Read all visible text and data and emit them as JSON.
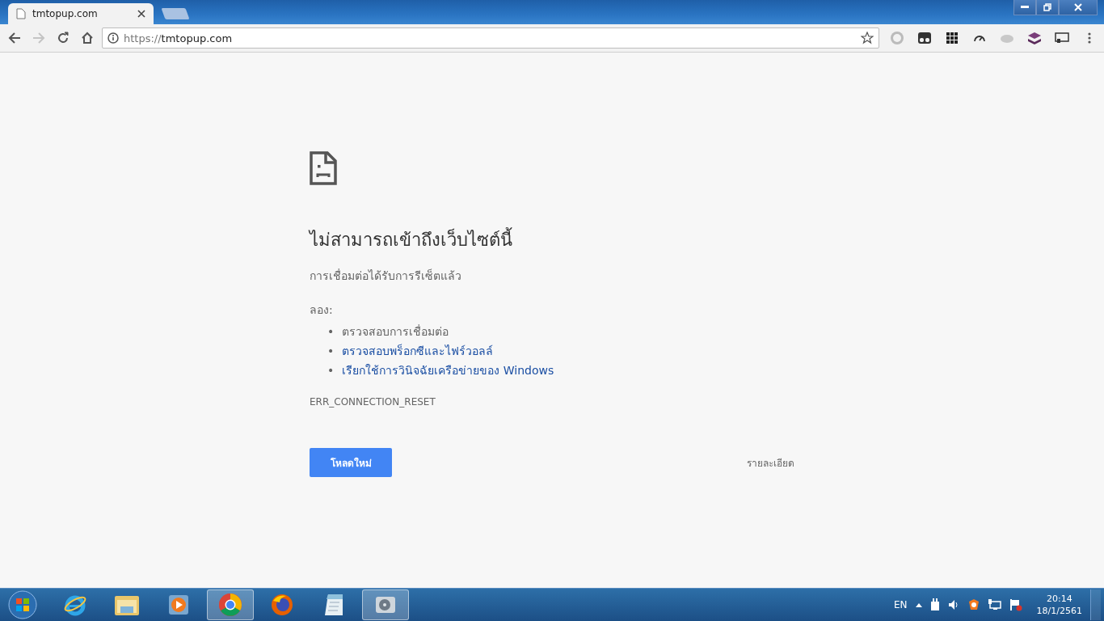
{
  "tabs": [
    {
      "title": "tmtopup.com",
      "selected": true
    }
  ],
  "navigation": {
    "back_disabled": false,
    "forward_disabled": true
  },
  "address_bar": {
    "scheme": "https://",
    "host": "tmtopup.com"
  },
  "error_page": {
    "heading": "ไม่สามารถเข้าถึงเว็บไซต์นี้",
    "description": "การเชื่อมต่อได้รับการรีเซ็ตแล้ว",
    "try_label": "ลอง:",
    "suggestions": [
      {
        "bullet": "•",
        "text": "ตรวจสอบการเชื่อมต่อ",
        "kind": "plain"
      },
      {
        "bullet": "•",
        "text": "ตรวจสอบพร็อกซีและไฟร์วอลล์",
        "kind": "link"
      },
      {
        "bullet": "•",
        "text": "เรียกใช้การวินิจฉัยเครือข่ายของ Windows",
        "kind": "link"
      }
    ],
    "error_code": "ERR_CONNECTION_RESET",
    "reload_button": "โหลดใหม่",
    "details_button": "รายละเอียด"
  },
  "taskbar": {
    "apps": [
      {
        "kind": "ie",
        "selected": false
      },
      {
        "kind": "folder",
        "selected": false
      },
      {
        "kind": "media",
        "selected": false
      },
      {
        "kind": "chrome",
        "selected": true
      },
      {
        "kind": "firefox",
        "selected": false
      },
      {
        "kind": "notepad",
        "selected": false
      },
      {
        "kind": "tool",
        "selected": true
      }
    ],
    "language": "EN",
    "time": "20:14",
    "date": "18/1/2561"
  }
}
